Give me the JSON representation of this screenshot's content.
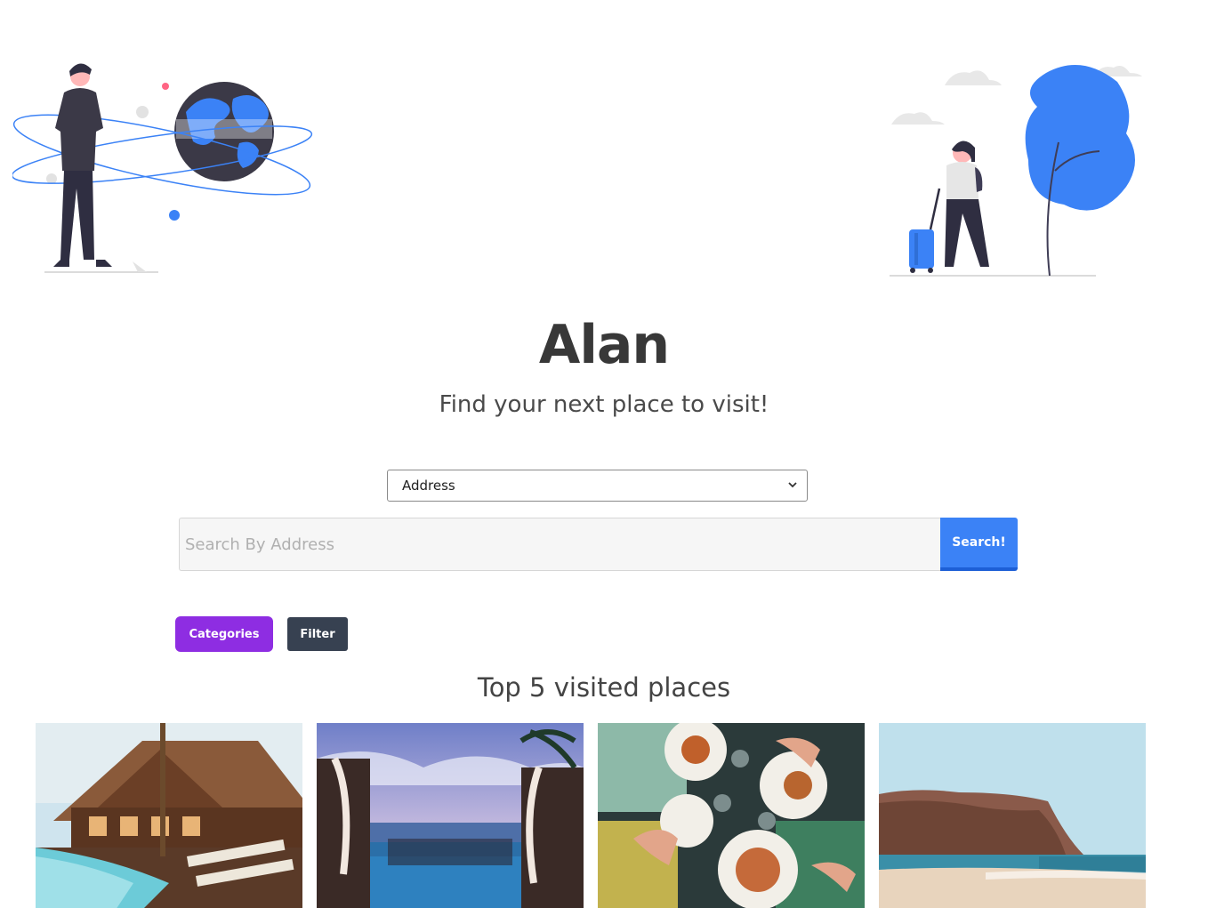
{
  "hero": {
    "brand": "Alan",
    "tagline": "Find your next place to visit!"
  },
  "search": {
    "select_value": "Address",
    "placeholder": "Search By Address",
    "value": "",
    "button_label": "Search!"
  },
  "actions": {
    "categories_label": "Categories",
    "filter_label": "Filter"
  },
  "top_places": {
    "title": "Top 5 visited places",
    "cards": [
      {
        "image": "resort-pool-lodge-photo"
      },
      {
        "image": "infinity-pool-cabanas-photo"
      },
      {
        "image": "food-table-overhead-photo"
      },
      {
        "image": "beach-cliff-photo"
      }
    ]
  },
  "colors": {
    "accent_blue": "#3b82f6",
    "purple": "#8e2de2",
    "dark": "#374151"
  }
}
